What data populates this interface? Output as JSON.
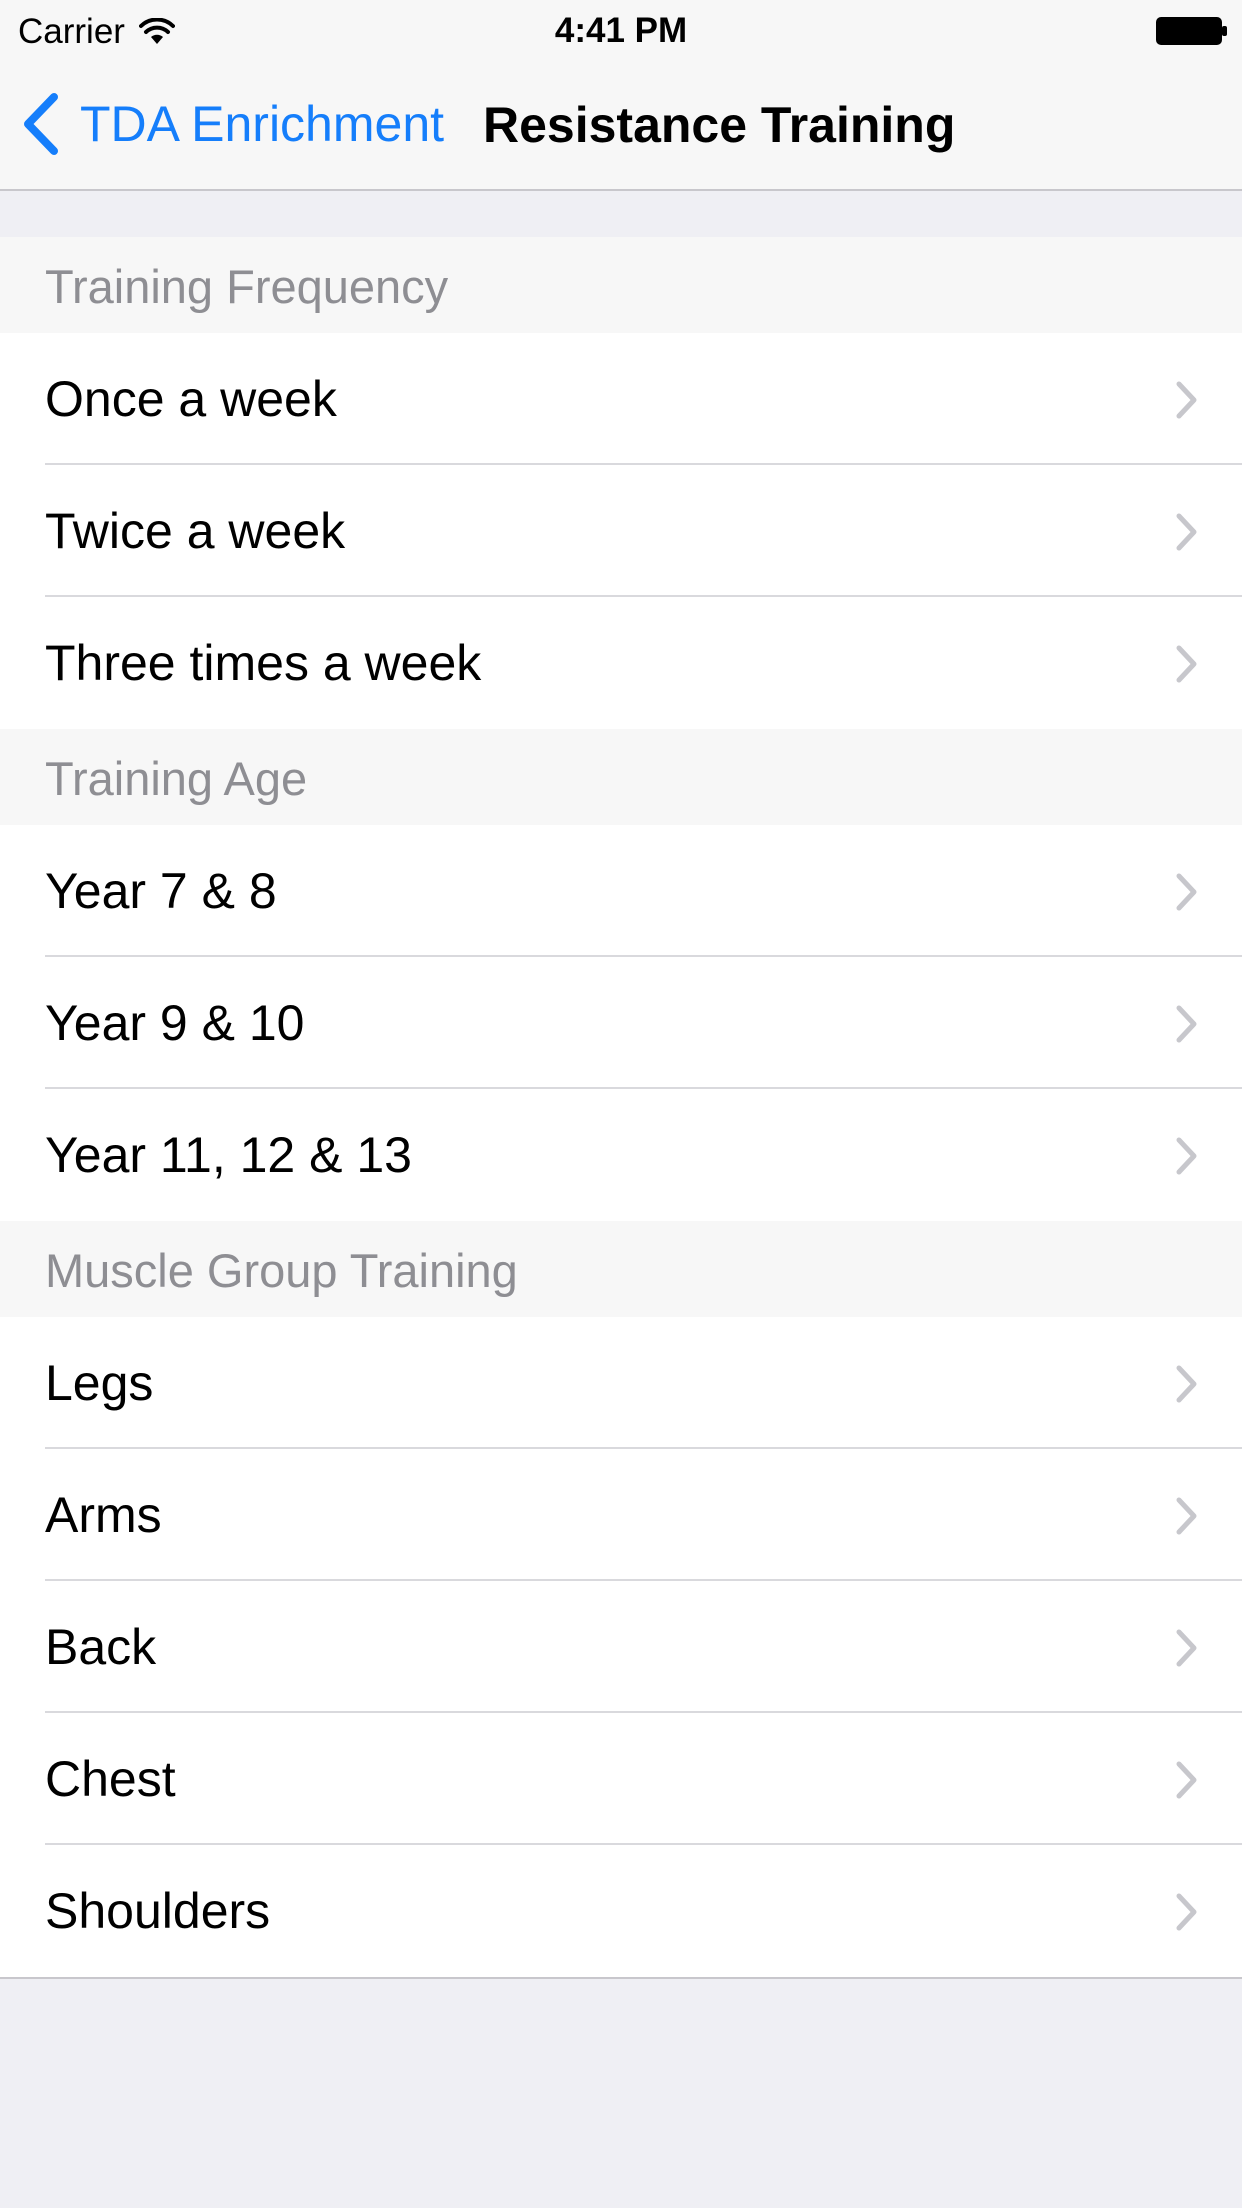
{
  "status_bar": {
    "carrier": "Carrier",
    "time": "4:41 PM",
    "wifi_icon": "wifi-icon",
    "battery_icon": "battery-icon"
  },
  "nav": {
    "back_label": "TDA Enrichment",
    "back_icon": "chevron-left-icon",
    "title": "Resistance Training"
  },
  "colors": {
    "accent": "#157efb",
    "background": "#efeff4",
    "section_text": "#8e8e93",
    "chevron": "#c7c7cc"
  },
  "sections": [
    {
      "header": "Training Frequency",
      "rows": [
        "Once a week",
        "Twice a week",
        "Three times a week"
      ]
    },
    {
      "header": "Training Age",
      "rows": [
        "Year 7 & 8",
        "Year 9 & 10",
        "Year 11, 12 & 13"
      ]
    },
    {
      "header": "Muscle Group Training",
      "rows": [
        "Legs",
        "Arms",
        "Back",
        "Chest",
        "Shoulders"
      ]
    }
  ]
}
